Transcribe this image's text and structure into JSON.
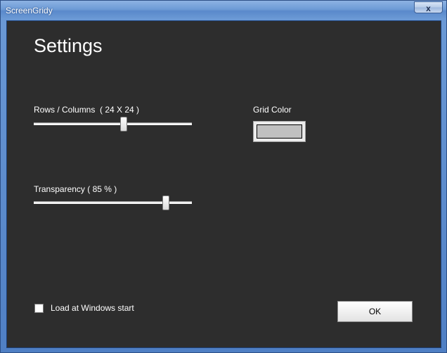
{
  "window": {
    "title": "ScreenGridy",
    "close_glyph": "x"
  },
  "settings": {
    "heading": "Settings",
    "rows_columns_label": "Rows / Columns  ( 24 X 24 )",
    "rows_columns_slider_fraction": 0.57,
    "grid_color_label": "Grid Color",
    "grid_color_value": "#c0c0c0",
    "transparency_label": "Transparency ( 85 % )",
    "transparency_slider_fraction": 0.85,
    "load_at_start_label": "Load at Windows start",
    "load_at_start_checked": false,
    "ok_label": "OK"
  },
  "colors": {
    "client_background": "#2d2d2d",
    "titlebar": "#6d9bd6"
  }
}
